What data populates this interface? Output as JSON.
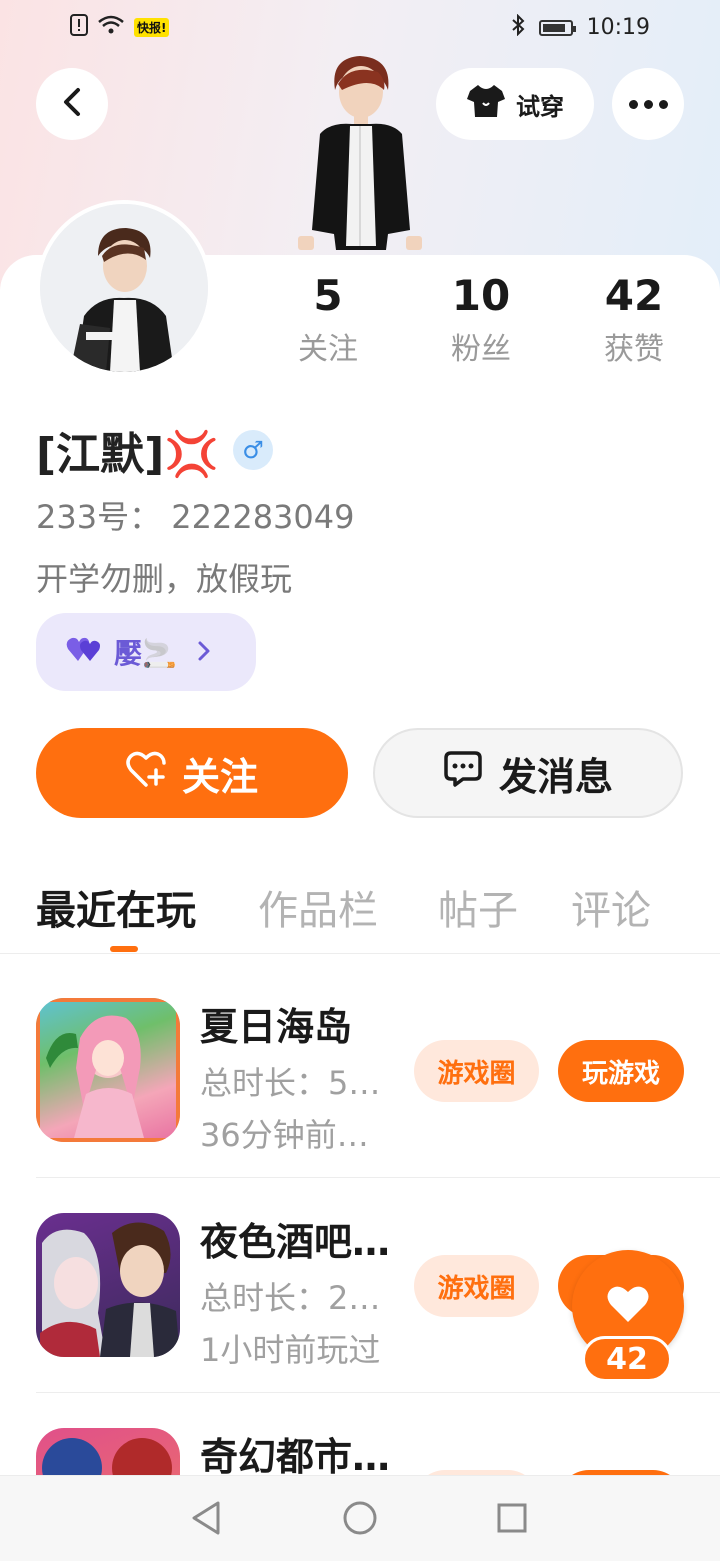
{
  "status_bar": {
    "time": "10:19",
    "icons": [
      "sim-alert-icon",
      "wifi-icon",
      "kuaibao-app-icon",
      "bluetooth-icon",
      "battery-icon"
    ],
    "app_badge_text": "快报!"
  },
  "header": {
    "try_on_label": "试穿"
  },
  "stats": [
    {
      "value": "5",
      "label": "关注"
    },
    {
      "value": "10",
      "label": "粉丝"
    },
    {
      "value": "42",
      "label": "获赞"
    }
  ],
  "profile": {
    "name": "[江默]💢",
    "gender_symbol": "♂",
    "uid": "233号：  222283049",
    "bio": "开学勿删，放假玩",
    "tag": "嬮🚬"
  },
  "actions": {
    "follow_label": "关注",
    "message_label": "发消息"
  },
  "tabs": [
    {
      "label": "最近在玩",
      "active": true
    },
    {
      "label": "作品栏",
      "active": false
    },
    {
      "label": "帖子",
      "active": false
    },
    {
      "label": "评论",
      "active": false
    }
  ],
  "games": [
    {
      "title": "夏日海岛",
      "duration": "总时长：5…",
      "last_played": "36分钟前…",
      "circle_label": "游戏圈",
      "play_label": "玩游戏"
    },
    {
      "title": "夜色酒吧…",
      "duration": "总时长：2…",
      "last_played": "1小时前玩过",
      "circle_label": "游戏圈",
      "play_label": ""
    },
    {
      "title": "奇幻都市…",
      "duration": "",
      "last_played": "",
      "circle_label": "",
      "play_label": ""
    }
  ],
  "like_float": {
    "count": "42"
  },
  "colors": {
    "accent": "#ff6f0f",
    "accent_light": "#ffe8dc",
    "tag_bg": "#ebe8fb",
    "tag_fg": "#6b5ad6",
    "gender_bg": "#d9ebfb"
  }
}
